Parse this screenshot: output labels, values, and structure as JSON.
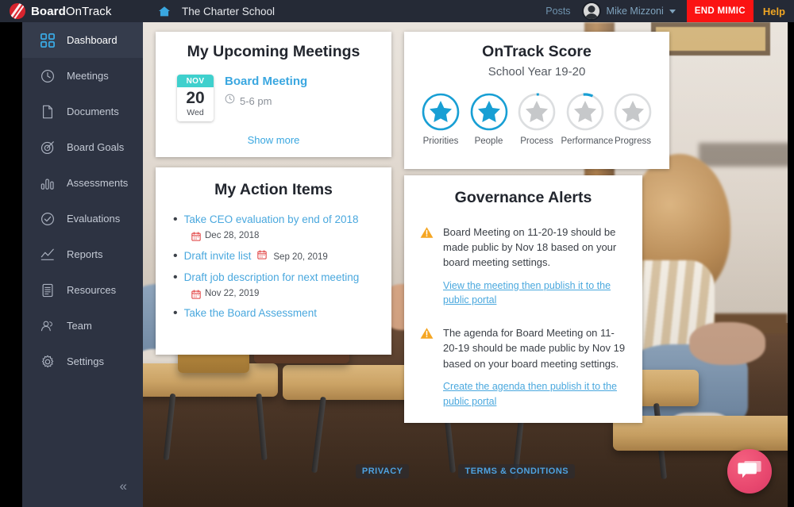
{
  "brand": {
    "name_bold": "Board",
    "name_rest": "OnTrack",
    "logo_color": "#d8242e"
  },
  "topbar": {
    "home_icon": "home-icon",
    "breadcrumb": "The Charter School",
    "posts_label": "Posts",
    "user_name": "Mike Mizzoni",
    "end_mimic_label": "END MIMIC",
    "end_mimic_color": "#fb1313",
    "help_label": "Help",
    "help_color": "#f0a623",
    "bg_color": "#252a36"
  },
  "sidebar": {
    "bg_color": "#2d3342",
    "collapse_glyph": "«",
    "items": [
      {
        "label": "Dashboard",
        "icon": "grid-icon",
        "active": true
      },
      {
        "label": "Meetings",
        "icon": "clock-icon",
        "active": false
      },
      {
        "label": "Documents",
        "icon": "document-icon",
        "active": false
      },
      {
        "label": "Board Goals",
        "icon": "target-icon",
        "active": false
      },
      {
        "label": "Assessments",
        "icon": "bar-chart-icon",
        "active": false
      },
      {
        "label": "Evaluations",
        "icon": "check-circle-icon",
        "active": false
      },
      {
        "label": "Reports",
        "icon": "line-chart-icon",
        "active": false
      },
      {
        "label": "Resources",
        "icon": "list-doc-icon",
        "active": false
      },
      {
        "label": "Team",
        "icon": "people-icon",
        "active": false
      },
      {
        "label": "Settings",
        "icon": "gear-icon",
        "active": false
      }
    ]
  },
  "meetings_card": {
    "title": "My Upcoming Meetings",
    "meeting": {
      "month": "NOV",
      "day": "20",
      "weekday": "Wed",
      "name": "Board Meeting",
      "time": "5-6 pm",
      "badge_color": "#3fd0cd"
    },
    "show_more_label": "Show more"
  },
  "score_card": {
    "title": "OnTrack Score",
    "subtitle": "School Year 19-20",
    "accent_color": "#189fd4",
    "inactive_color": "#c6c8ca",
    "stars": [
      {
        "label": "Priorities",
        "filled": true,
        "progress": 100
      },
      {
        "label": "People",
        "filled": true,
        "progress": 100
      },
      {
        "label": "Process",
        "filled": false,
        "progress": 2
      },
      {
        "label": "Performance",
        "filled": false,
        "progress": 9
      },
      {
        "label": "Progress",
        "filled": false,
        "progress": 0
      }
    ]
  },
  "action_items_card": {
    "title": "My Action Items",
    "items": [
      {
        "text": "Take CEO evaluation by end of 2018",
        "date": "Dec 28, 2018",
        "date_inline": false
      },
      {
        "text": "Draft invite list",
        "date": "Sep 20, 2019",
        "date_inline": true
      },
      {
        "text": "Draft job description for next meeting",
        "date": "Nov 22, 2019",
        "date_inline": false
      },
      {
        "text": "Take the Board Assessment",
        "date": "",
        "date_inline": false
      }
    ]
  },
  "alerts_card": {
    "title": "Governance Alerts",
    "warning_color": "#f5a623",
    "alerts": [
      {
        "text": "Board Meeting on 11-20-19 should be made public by Nov 18 based on your board meeting settings.",
        "link": "View the meeting then publish it to the public portal"
      },
      {
        "text": "The agenda for Board Meeting on 11-20-19 should be made public by Nov 19 based on your board meeting settings.",
        "link": "Create the agenda then publish it to the public portal"
      }
    ]
  },
  "footer": {
    "privacy_label": "PRIVACY",
    "terms_label": "TERMS & CONDITIONS"
  },
  "chat": {
    "icon": "chat-bubble-icon",
    "color": "#e8486f"
  }
}
